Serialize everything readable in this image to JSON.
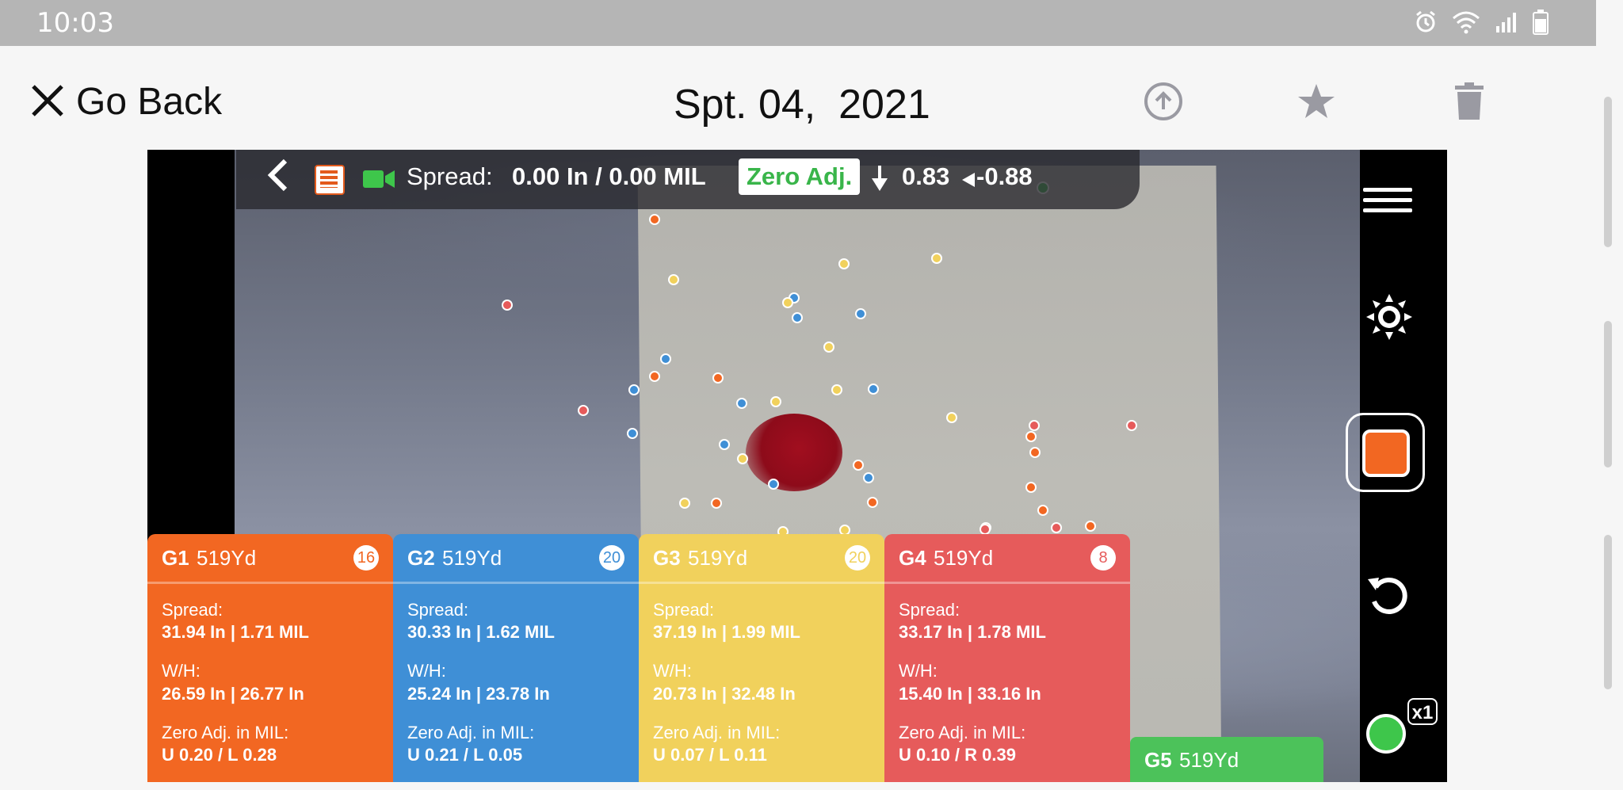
{
  "status_bar": {
    "time": "10:03"
  },
  "header": {
    "back_label": "Go Back",
    "date": "Spt. 04,  2021"
  },
  "topbar": {
    "spread_label": "Spread:",
    "spread_value": "0.00 In / 0.00 MIL",
    "zero_adj_label": "Zero Adj.",
    "elevation_value": "0.83",
    "windage_value": "0.88"
  },
  "colors": {
    "g1": "#f26722",
    "g2": "#3f8fd6",
    "g3": "#f1d15c",
    "g4": "#e65b5b",
    "g5": "#4cc25a",
    "zero_adj_text": "#39b54a"
  },
  "groups": [
    {
      "name": "G1",
      "distance": "519Yd",
      "count": "16",
      "spread_label": "Spread:",
      "spread": "31.94 In | 1.71 MIL",
      "wh_label": "W/H:",
      "wh": "26.59 In | 26.77 In",
      "zero_label": "Zero Adj. in MIL:",
      "zero": "U 0.20 / L 0.28"
    },
    {
      "name": "G2",
      "distance": "519Yd",
      "count": "20",
      "spread_label": "Spread:",
      "spread": "30.33 In | 1.62 MIL",
      "wh_label": "W/H:",
      "wh": "25.24 In | 23.78 In",
      "zero_label": "Zero Adj. in MIL:",
      "zero": "U 0.21 / L 0.05"
    },
    {
      "name": "G3",
      "distance": "519Yd",
      "count": "20",
      "spread_label": "Spread:",
      "spread": "37.19 In | 1.99 MIL",
      "wh_label": "W/H:",
      "wh": "20.73 In | 32.48 In",
      "zero_label": "Zero Adj. in MIL:",
      "zero": "U 0.07 / L 0.11"
    },
    {
      "name": "G4",
      "distance": "519Yd",
      "count": "8",
      "spread_label": "Spread:",
      "spread": "33.17 In | 1.78 MIL",
      "wh_label": "W/H:",
      "wh": "15.40 In | 33.16 In",
      "zero_label": "Zero Adj. in MIL:",
      "zero": "U 0.10 / R 0.39"
    }
  ],
  "g5": {
    "name": "G5",
    "distance": "519Yd"
  },
  "zoom_badge": "x1",
  "icons": {
    "close": "close-icon",
    "upload": "upload-icon",
    "star": "star-icon",
    "trash": "trash-icon",
    "menu": "menu-icon",
    "brightness": "brightness-icon",
    "record": "record-icon",
    "undo": "undo-icon"
  }
}
